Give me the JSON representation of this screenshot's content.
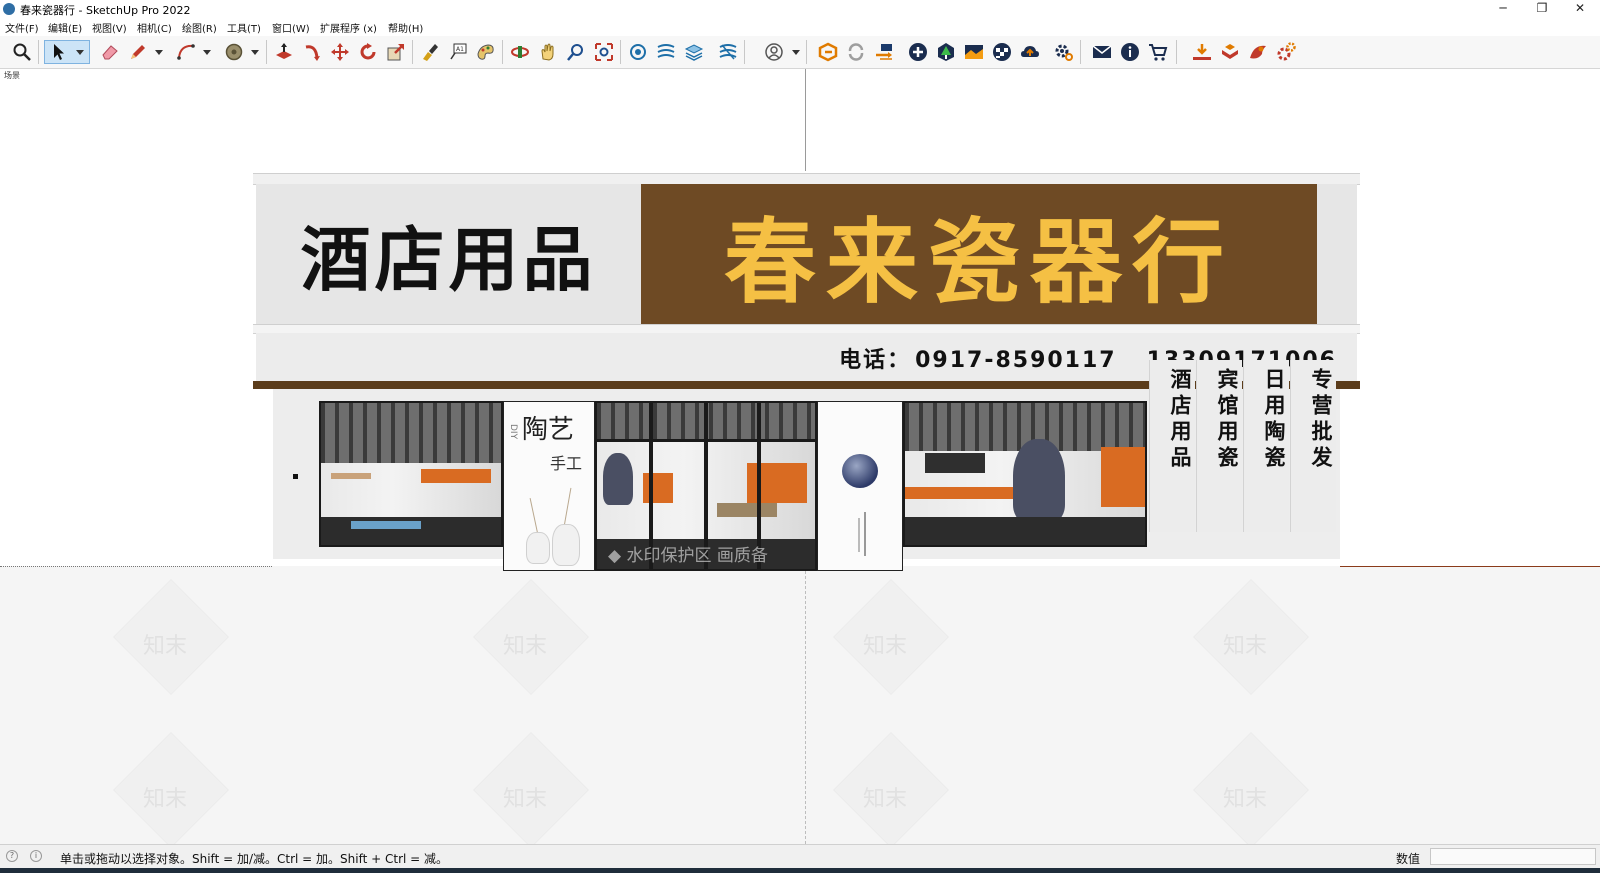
{
  "window": {
    "title": "春来瓷器行 - SketchUp Pro 2022",
    "controls": {
      "minimize": "─",
      "restore": "❐",
      "close": "✕"
    }
  },
  "menu": [
    "文件(F)",
    "编辑(E)",
    "视图(V)",
    "相机(C)",
    "绘图(R)",
    "工具(T)",
    "窗口(W)",
    "扩展程序 (x)",
    "帮助(H)"
  ],
  "toolbar": {
    "active_tool": "select-tool",
    "groups": [
      [
        "zoom-icon",
        "select-icon",
        "eraser-icon",
        "pencil-icon",
        "arc-icon",
        "tape-measure-icon"
      ],
      [
        "push-pull-icon",
        "follow-me-icon",
        "move-icon",
        "rotate-icon",
        "scale-icon"
      ],
      [
        "paint-bucket-icon",
        "text-icon",
        "material-icon"
      ],
      [
        "orbit-icon",
        "pan-icon",
        "zoom-window-icon",
        "zoom-extents-icon"
      ],
      [
        "components-icon",
        "styles-icon",
        "layers-icon",
        "scenes-icon"
      ],
      [
        "user-icon"
      ],
      [
        "extension-logo-icon",
        "sync-icon",
        "transfer-icon",
        "add-icon",
        "tree-icon",
        "landscape-icon",
        "checker-icon",
        "cloud-upload-icon",
        "settings-icon"
      ],
      [
        "mail-icon",
        "info-icon",
        "cart-icon"
      ],
      [
        "download-icon",
        "import-icon",
        "render-icon",
        "render-settings-icon"
      ]
    ]
  },
  "scene": {
    "tab_label": "场景"
  },
  "storefront": {
    "left_sign": "酒店用品",
    "brand_sign": "春来瓷器行",
    "phone_label": "电话：",
    "phone_1": "0917-8590117",
    "phone_2": "13309171006",
    "poster_title": "陶艺",
    "poster_sub": "手工",
    "poster_diy": "DIY",
    "vertical_panels": [
      "酒店用品",
      "宾馆用瓷",
      "日用陶瓷",
      "专营批发"
    ],
    "watermark": "◆ 水印保护区   画质备",
    "ground_watermark": "知末"
  },
  "colors": {
    "brand_bg": "#6e4a24",
    "brand_text": "#f5c044",
    "accent_orange": "#d96b22"
  },
  "status": {
    "hint": "单击或拖动以选择对象。Shift = 加/减。Ctrl = 加。Shift + Ctrl = 减。",
    "measurements_label": "数值",
    "measurements_value": ""
  }
}
